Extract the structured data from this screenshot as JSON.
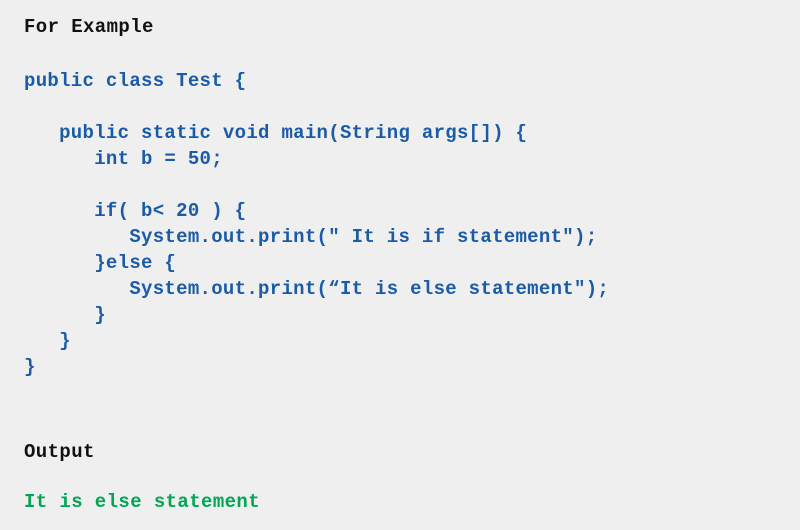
{
  "background_color": "#efefef",
  "colors": {
    "heading": "#111111",
    "code": "#1a5ba8",
    "output": "#00a651"
  },
  "headings": {
    "example": "For Example",
    "output": "Output"
  },
  "code": {
    "language": "java",
    "lines": [
      "public class Test {",
      "",
      "   public static void main(String args[]) {",
      "      int b = 50;",
      "",
      "      if( b< 20 ) {",
      "         System.out.print(\" It is if statement\");",
      "      }else {",
      "         System.out.print(“It is else statement\");",
      "      }",
      "   }",
      "}"
    ]
  },
  "output": {
    "text": "It is else statement"
  }
}
